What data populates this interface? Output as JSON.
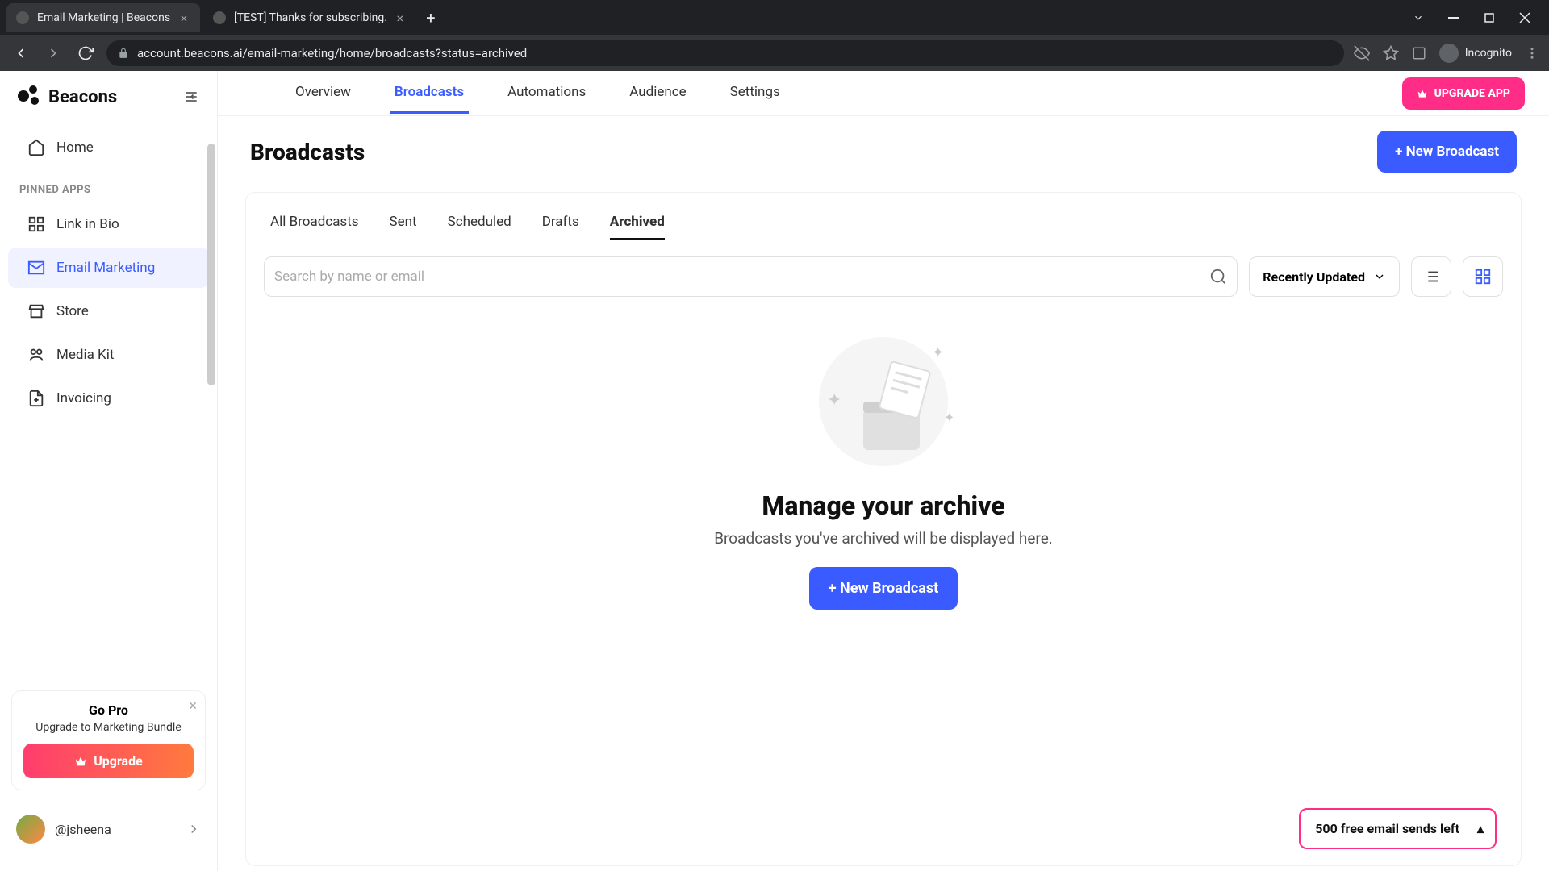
{
  "browser": {
    "tabs": [
      {
        "title": "Email Marketing | Beacons",
        "active": true
      },
      {
        "title": "[TEST] Thanks for subscribing.",
        "active": false
      }
    ],
    "url": "account.beacons.ai/email-marketing/home/broadcasts?status=archived",
    "incognito_label": "Incognito"
  },
  "sidebar": {
    "brand": "Beacons",
    "home": "Home",
    "section_pinned": "PINNED APPS",
    "items": [
      {
        "label": "Link in Bio"
      },
      {
        "label": "Email Marketing"
      },
      {
        "label": "Store"
      },
      {
        "label": "Media Kit"
      },
      {
        "label": "Invoicing"
      }
    ],
    "gopro": {
      "title": "Go Pro",
      "subtitle": "Upgrade to Marketing Bundle",
      "button": "Upgrade"
    },
    "user_handle": "@jsheena"
  },
  "topnav": {
    "tabs": [
      "Overview",
      "Broadcasts",
      "Automations",
      "Audience",
      "Settings"
    ],
    "active_index": 1,
    "upgrade_app": "UPGRADE APP"
  },
  "page": {
    "title": "Broadcasts",
    "new_broadcast": "+ New Broadcast"
  },
  "filters": {
    "tabs": [
      "All Broadcasts",
      "Sent",
      "Scheduled",
      "Drafts",
      "Archived"
    ],
    "active_index": 4
  },
  "search": {
    "placeholder": "Search by name or email"
  },
  "sort": {
    "label": "Recently Updated"
  },
  "empty": {
    "title": "Manage your archive",
    "subtitle": "Broadcasts you've archived will be displayed here.",
    "button": "+ New Broadcast"
  },
  "quota": {
    "label": "500 free email sends left"
  }
}
